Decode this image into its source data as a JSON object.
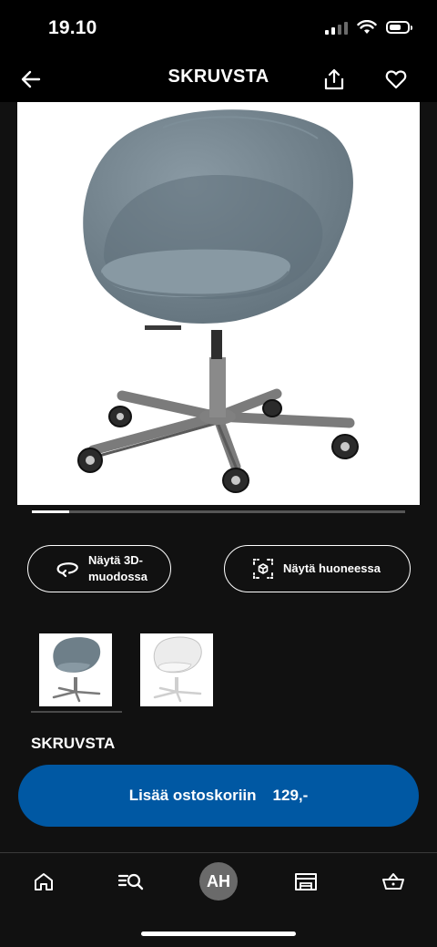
{
  "status": {
    "time": "19.10"
  },
  "header": {
    "title": "SKRUVSTA"
  },
  "gallery": {
    "progress": 0.1
  },
  "actions": {
    "view_3d_line1": "Näytä 3D-",
    "view_3d_line2": "muodossa",
    "view_in_room": "Näytä huoneessa"
  },
  "thumbnails": [
    {
      "color": "#6e7f89"
    },
    {
      "color": "#ececec"
    }
  ],
  "product": {
    "name": "SKRUVSTA"
  },
  "cart": {
    "label": "Lisää ostoskoriin",
    "price": "129,-"
  },
  "tabbar": {
    "avatar_initials": "AH"
  },
  "colors": {
    "accent": "#0058a3",
    "background": "#111111"
  }
}
